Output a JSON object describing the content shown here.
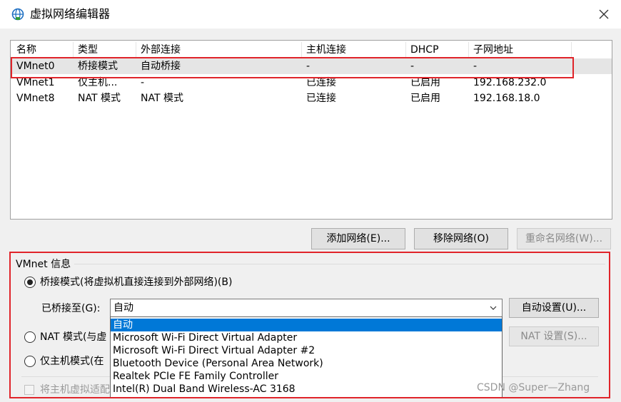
{
  "window": {
    "title": "虚拟网络编辑器",
    "icon": "network-globe-icon"
  },
  "network_table": {
    "columns": [
      "名称",
      "类型",
      "外部连接",
      "主机连接",
      "DHCP",
      "子网地址"
    ],
    "rows": [
      [
        "VMnet0",
        "桥接模式",
        "自动桥接",
        "-",
        "-",
        "-"
      ],
      [
        "VMnet1",
        "仅主机...",
        "-",
        "已连接",
        "已启用",
        "192.168.232.0"
      ],
      [
        "VMnet8",
        "NAT 模式",
        "NAT 模式",
        "已连接",
        "已启用",
        "192.168.18.0"
      ]
    ],
    "selected_row": "VMnet0"
  },
  "table_buttons": {
    "add": "添加网络(E)...",
    "remove": "移除网络(O)",
    "rename": "重命名网络(W)..."
  },
  "vmnet_info": {
    "group_label": "VMnet 信息",
    "bridged_label": "桥接模式(将虚拟机直接连接到外部网络)(B)",
    "bridged_to_label": "已桥接至(G):",
    "bridged_to_value": "自动",
    "auto_settings": "自动设置(U)...",
    "nat_label": "NAT 模式(与虚",
    "nat_settings": "NAT 设置(S)...",
    "host_only_label": "仅主机模式(在",
    "connect_host_label": "将主机虚拟适配",
    "selected_mode": "bridged"
  },
  "dropdown": {
    "options": [
      "自动",
      "Microsoft Wi-Fi Direct Virtual Adapter",
      "Microsoft Wi-Fi Direct Virtual Adapter #2",
      "Bluetooth Device (Personal Area Network)",
      "Realtek PCIe FE Family Controller",
      "Intel(R) Dual Band Wireless-AC 3168"
    ],
    "highlighted": "自动"
  },
  "watermark": "CSDN @Super—Zhang",
  "colors": {
    "annotation_red": "#e0242a",
    "highlight_blue": "#0078d7",
    "dialog_bg": "#f0f0f0"
  }
}
